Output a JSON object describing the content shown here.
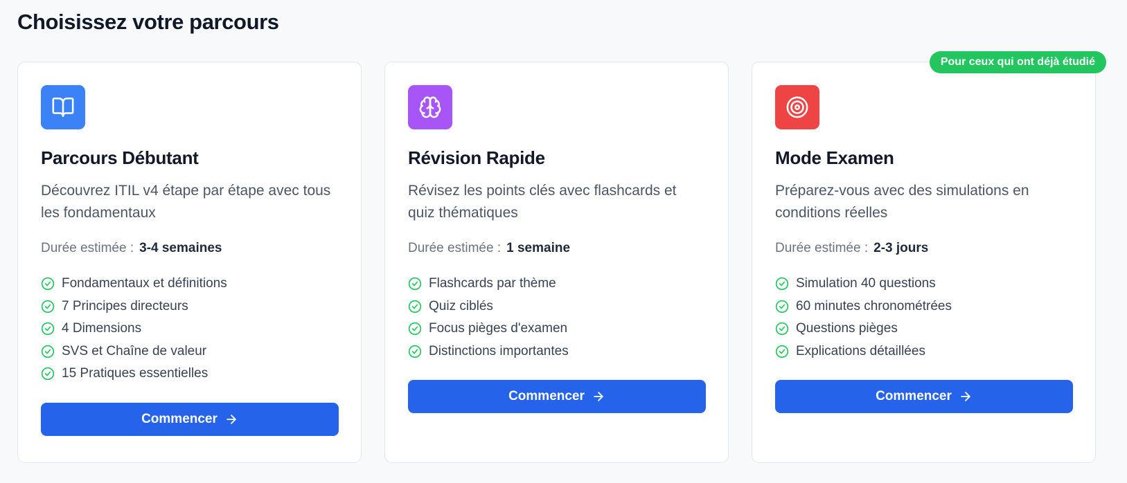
{
  "page": {
    "title": "Choisissez votre parcours"
  },
  "cards": [
    {
      "title": "Parcours Débutant",
      "description": "Découvrez ITIL v4 étape par étape avec tous les fondamentaux",
      "duration_label": "Durée estimée :",
      "duration_value": "3-4 semaines",
      "icon": "book-open-icon",
      "icon_color": "#3b82f6",
      "features": [
        "Fondamentaux et définitions",
        "7 Principes directeurs",
        "4 Dimensions",
        "SVS et Chaîne de valeur",
        "15 Pratiques essentielles"
      ],
      "button_label": "Commencer"
    },
    {
      "title": "Révision Rapide",
      "description": "Révisez les points clés avec flashcards et quiz thématiques",
      "duration_label": "Durée estimée :",
      "duration_value": "1 semaine",
      "icon": "brain-icon",
      "icon_color": "#a855f7",
      "features": [
        "Flashcards par thème",
        "Quiz ciblés",
        "Focus pièges d'examen",
        "Distinctions importantes"
      ],
      "button_label": "Commencer"
    },
    {
      "title": "Mode Examen",
      "description": "Préparez-vous avec des simulations en conditions réelles",
      "duration_label": "Durée estimée :",
      "duration_value": "2-3 jours",
      "icon": "target-icon",
      "icon_color": "#ef4444",
      "badge": "Pour ceux qui ont déjà étudié",
      "badge_color": "#22c55e",
      "features": [
        "Simulation 40 questions",
        "60 minutes chronométrées",
        "Questions pièges",
        "Explications détaillées"
      ],
      "button_label": "Commencer"
    }
  ],
  "colors": {
    "accent": "#2563eb",
    "check": "#22c55e"
  }
}
